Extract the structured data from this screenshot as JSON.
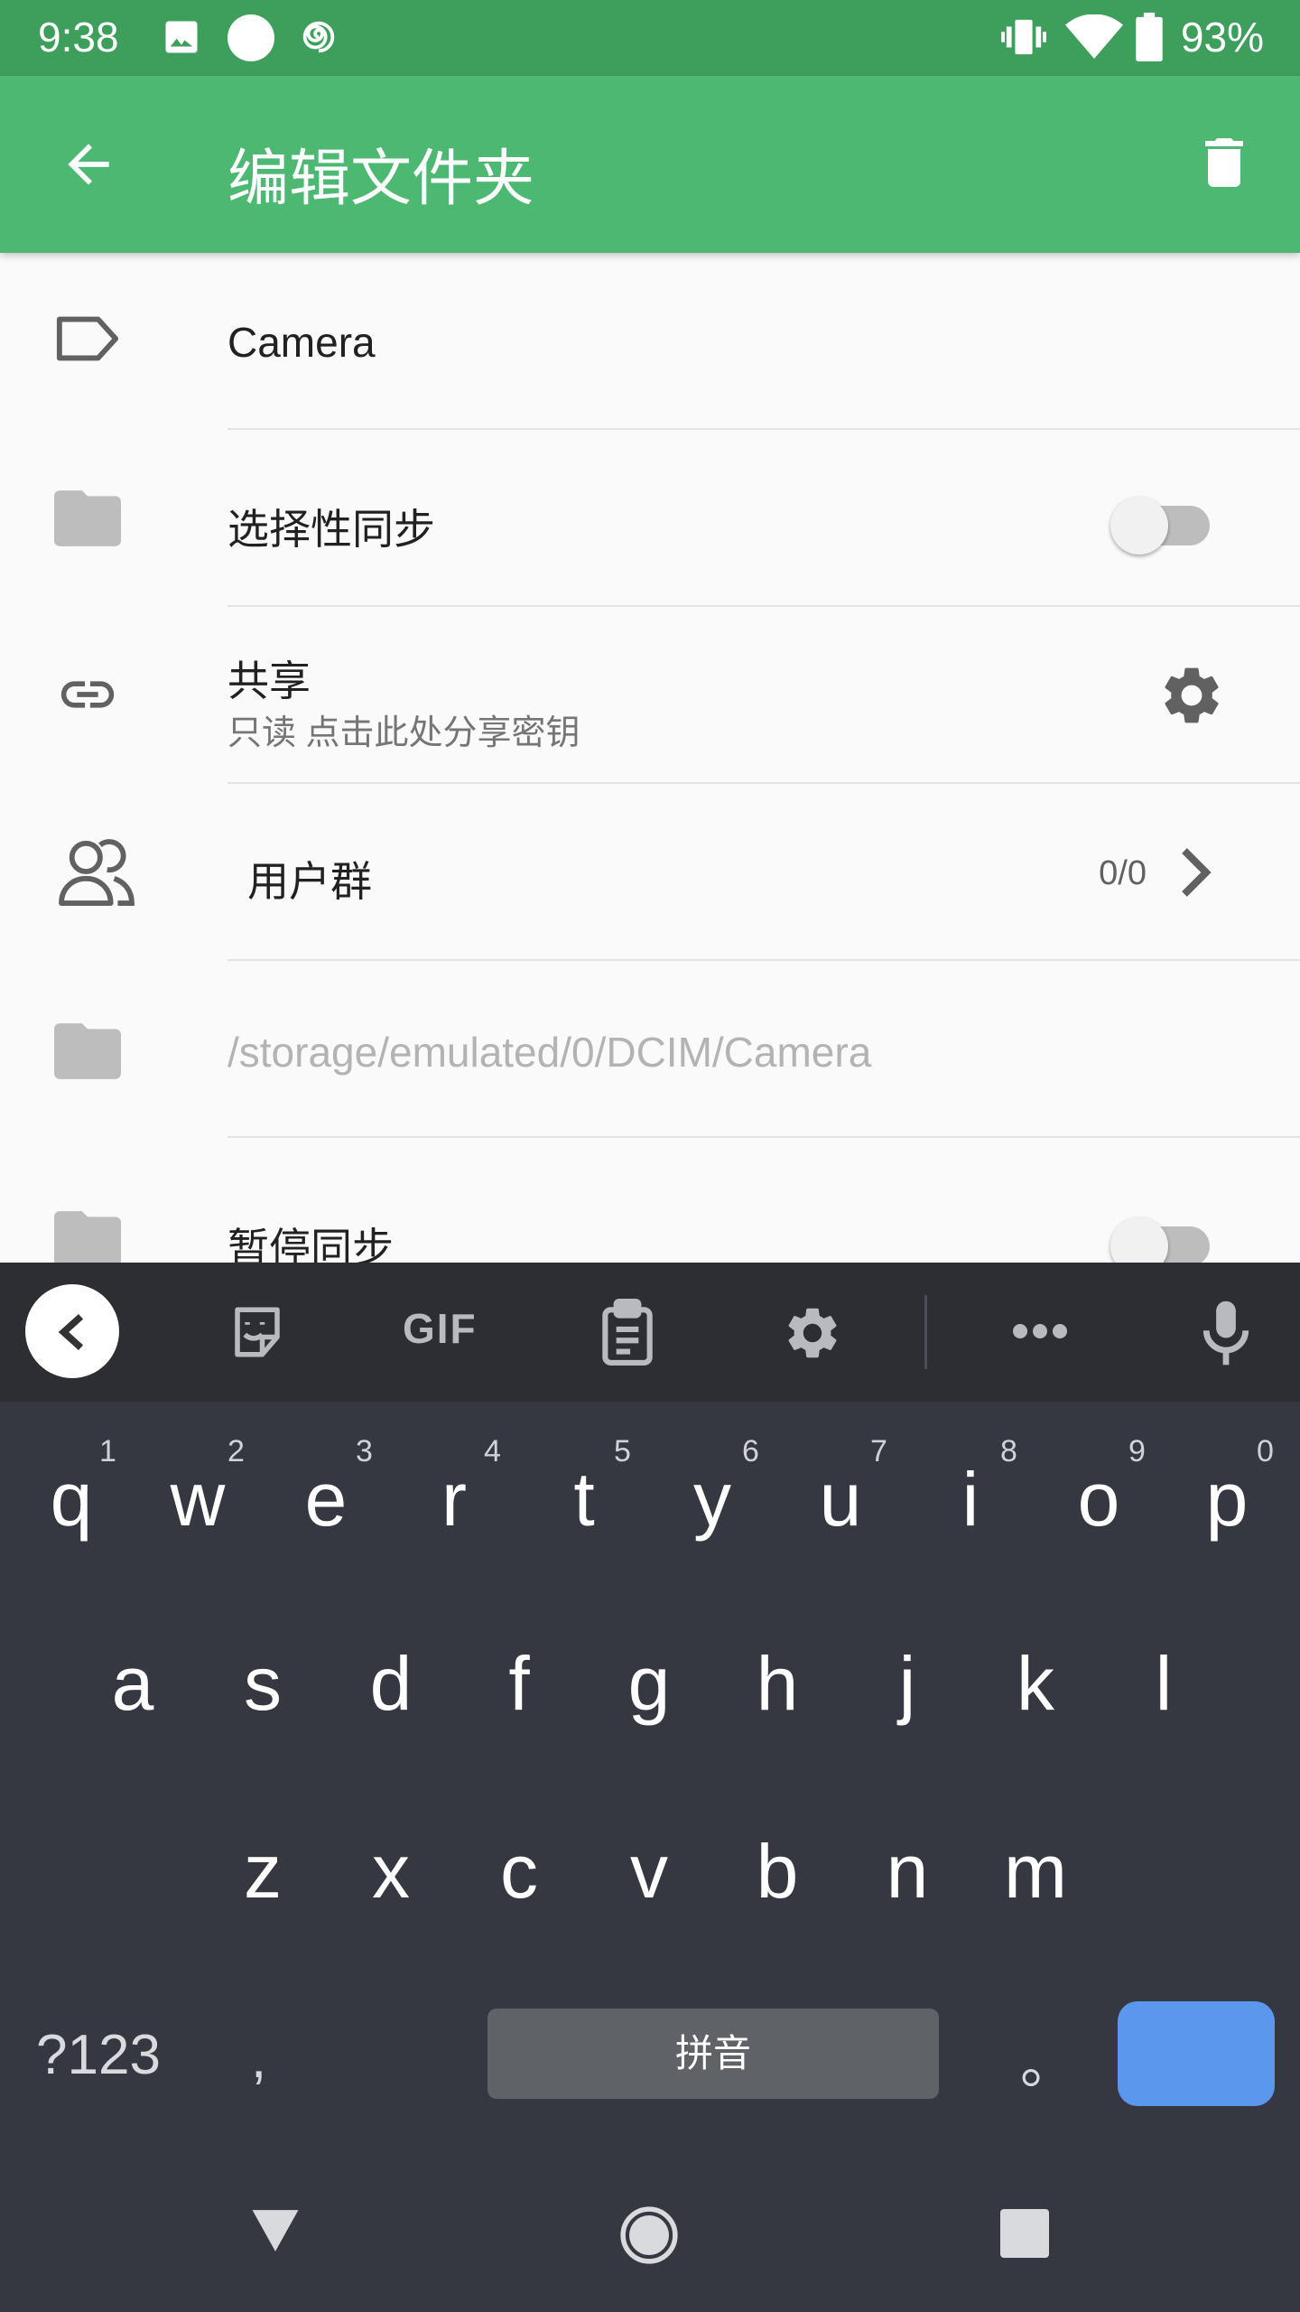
{
  "status_bar": {
    "time": "9:38",
    "battery": "93%",
    "left_icons": [
      "image-icon",
      "circle-icon",
      "swirl-icon"
    ],
    "right_icons": [
      "vibrate-icon",
      "wifi-icon",
      "battery-icon"
    ]
  },
  "app_bar": {
    "title": "编辑文件夹",
    "back_icon": "arrow-left-icon",
    "delete_icon": "trash-icon",
    "background": "#4cb872"
  },
  "rows": {
    "label": {
      "value": "Camera",
      "icon": "label-tag-icon"
    },
    "selective_sync": {
      "label": "选择性同步",
      "icon": "folder-icon",
      "enabled": false
    },
    "share": {
      "label": "共享",
      "sub": "只读 点击此处分享密钥",
      "icon": "link-icon",
      "action_icon": "gear-icon"
    },
    "user_group": {
      "label": "用户群",
      "count": "0/0",
      "icon": "people-icon"
    },
    "path": {
      "value": "/storage/emulated/0/DCIM/Camera",
      "icon": "folder-icon"
    },
    "pause_sync": {
      "label": "暂停同步",
      "icon": "folder-icon",
      "enabled": false
    }
  },
  "keyboard": {
    "toolbar_gif": "GIF",
    "row1": [
      "q",
      "w",
      "e",
      "r",
      "t",
      "y",
      "u",
      "i",
      "o",
      "p"
    ],
    "row1_hints": [
      "1",
      "2",
      "3",
      "4",
      "5",
      "6",
      "7",
      "8",
      "9",
      "0"
    ],
    "row2": [
      "a",
      "s",
      "d",
      "f",
      "g",
      "h",
      "j",
      "k",
      "l"
    ],
    "row3": [
      "z",
      "x",
      "c",
      "v",
      "b",
      "n",
      "m"
    ],
    "symbols_key": "?123",
    "comma_key": ",",
    "space_label": "拼音",
    "period_key": "。",
    "enter_color": "#5b97ec"
  }
}
